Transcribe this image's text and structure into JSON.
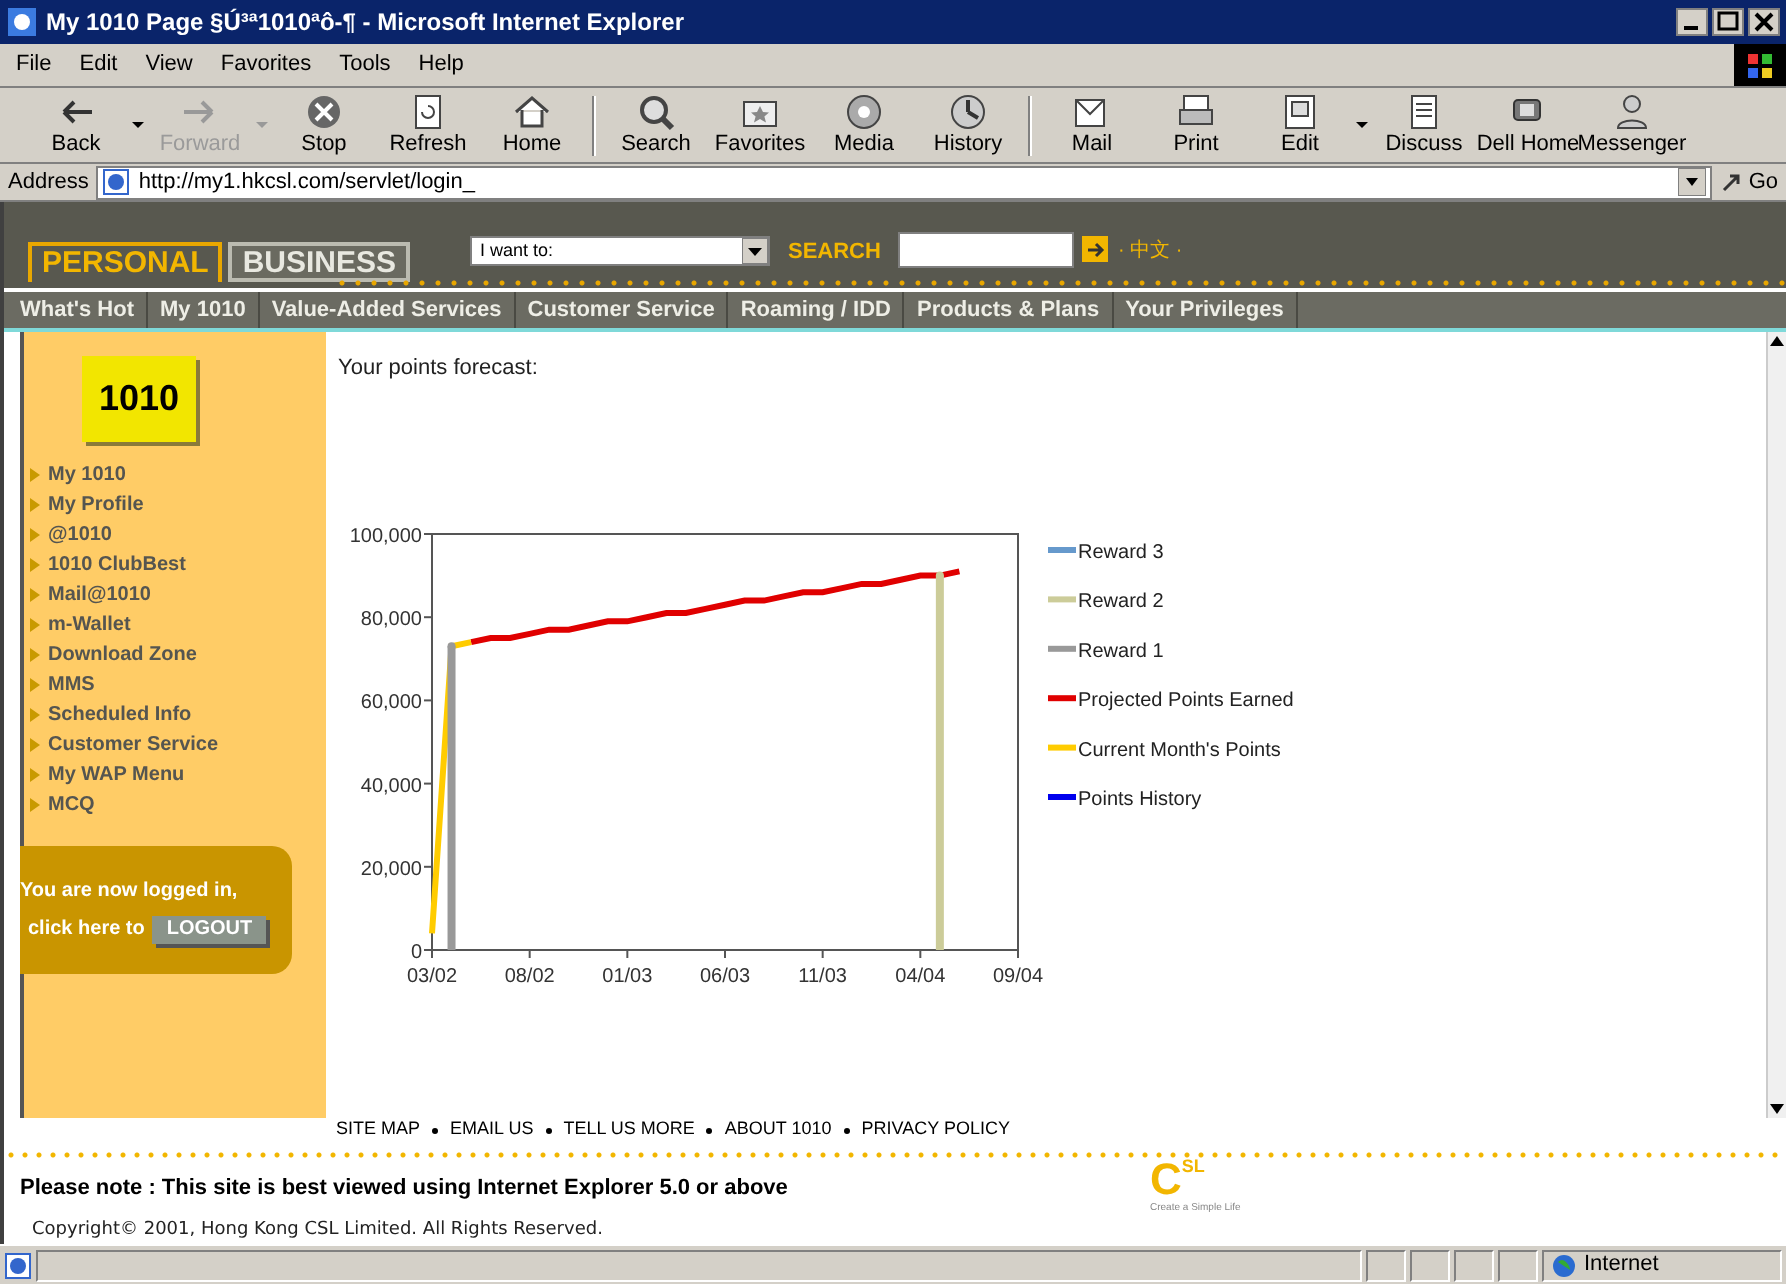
{
  "window": {
    "title": "My 1010 Page §Ú³ª1010ªô-¶ - Microsoft Internet Explorer"
  },
  "menu": [
    "File",
    "Edit",
    "View",
    "Favorites",
    "Tools",
    "Help"
  ],
  "toolbar": [
    {
      "label": "Back",
      "disabled": false,
      "dropdown": true
    },
    {
      "label": "Forward",
      "disabled": true,
      "dropdown": true
    },
    {
      "label": "Stop",
      "disabled": false,
      "dropdown": false
    },
    {
      "label": "Refresh",
      "disabled": false,
      "dropdown": false
    },
    {
      "label": "Home",
      "disabled": false,
      "dropdown": false
    },
    {
      "label": "Search",
      "disabled": false,
      "dropdown": false
    },
    {
      "label": "Favorites",
      "disabled": false,
      "dropdown": false
    },
    {
      "label": "Media",
      "disabled": false,
      "dropdown": false
    },
    {
      "label": "History",
      "disabled": false,
      "dropdown": false
    },
    {
      "label": "Mail",
      "disabled": false,
      "dropdown": false
    },
    {
      "label": "Print",
      "disabled": false,
      "dropdown": false
    },
    {
      "label": "Edit",
      "disabled": false,
      "dropdown": true
    },
    {
      "label": "Discuss",
      "disabled": false,
      "dropdown": false
    },
    {
      "label": "Dell Home",
      "disabled": false,
      "dropdown": false
    },
    {
      "label": "Messenger",
      "disabled": false,
      "dropdown": false
    }
  ],
  "address": {
    "label": "Address",
    "value": "http://my1.hkcsl.com/servlet/login_",
    "go": "Go"
  },
  "site_header": {
    "tabs": [
      {
        "label": "PERSONAL",
        "selected": true
      },
      {
        "label": "BUSINESS",
        "selected": false
      }
    ],
    "select": "I want to:",
    "search_label": "SEARCH",
    "language": "· 中文 ·"
  },
  "nav": [
    "What's Hot",
    "My 1010",
    "Value-Added Services",
    "Customer Service",
    "Roaming / IDD",
    "Products & Plans",
    "Your Privileges"
  ],
  "sidebar": {
    "logo": "1010",
    "items": [
      "My 1010",
      "My Profile",
      "@1010",
      "1010 ClubBest",
      "Mail@1010",
      "m-Wallet",
      "Download Zone",
      "MMS",
      "Scheduled Info",
      "Customer Service",
      "My WAP Menu",
      "MCQ"
    ],
    "login": {
      "line_1": "You are now logged in,",
      "line_2": "click here to",
      "button": "LOGOUT"
    }
  },
  "content": {
    "heading": "Your points forecast:",
    "chart_data": {
      "type": "line",
      "categories": [
        "03/02",
        null,
        null,
        null,
        null,
        "08/02",
        null,
        null,
        null,
        null,
        "01/03",
        null,
        null,
        null,
        null,
        "06/03",
        null,
        null,
        null,
        null,
        "11/03",
        null,
        null,
        null,
        null,
        "04/04",
        null,
        null,
        null,
        null,
        "09/04"
      ],
      "ylim": [
        0,
        100000
      ],
      "legend": true,
      "yticks": [
        {
          "value": 0,
          "label": "0"
        },
        {
          "value": 20000,
          "label": "20,000"
        },
        {
          "value": 40000,
          "label": "40,000"
        },
        {
          "value": 60000,
          "label": "60,000"
        },
        {
          "value": 80000,
          "label": "80,000"
        },
        {
          "value": 100000,
          "label": "100,000"
        }
      ],
      "series": [
        {
          "name": "Reward 3",
          "color": "#6699cc",
          "values": [
            null,
            null,
            null,
            null,
            null,
            null,
            null,
            null,
            null,
            null,
            null,
            null,
            null,
            null,
            null,
            null,
            null,
            null,
            null,
            null,
            null,
            null,
            null,
            null,
            null,
            null,
            null,
            null,
            null,
            null,
            null
          ]
        },
        {
          "name": "Reward 2",
          "color": "#cccc99",
          "marker": true,
          "values": [
            null,
            null,
            null,
            null,
            null,
            null,
            null,
            null,
            null,
            null,
            null,
            null,
            null,
            null,
            null,
            null,
            null,
            null,
            null,
            null,
            null,
            null,
            null,
            null,
            null,
            null,
            90000,
            null,
            null,
            null,
            null
          ]
        },
        {
          "name": "Reward 1",
          "color": "#999999",
          "marker": true,
          "values": [
            null,
            73000,
            null,
            null,
            null,
            null,
            null,
            null,
            null,
            null,
            null,
            null,
            null,
            null,
            null,
            null,
            null,
            null,
            null,
            null,
            null,
            null,
            null,
            null,
            null,
            null,
            null,
            null,
            null,
            null,
            null
          ]
        },
        {
          "name": "Projected Points Earned",
          "color": "#e00000",
          "values": [
            null,
            null,
            74000,
            75000,
            75000,
            76000,
            77000,
            77000,
            78000,
            79000,
            79000,
            80000,
            81000,
            81000,
            82000,
            83000,
            84000,
            84000,
            85000,
            86000,
            86000,
            87000,
            88000,
            88000,
            89000,
            90000,
            90000,
            91000,
            null,
            null,
            null
          ]
        },
        {
          "name": "Current Month's Points",
          "color": "#ffcc00",
          "values": [
            4000,
            73000,
            74000,
            null,
            null,
            null,
            null,
            null,
            null,
            null,
            null,
            null,
            null,
            null,
            null,
            null,
            null,
            null,
            null,
            null,
            null,
            null,
            null,
            null,
            null,
            null,
            null,
            null,
            null,
            null,
            null
          ]
        },
        {
          "name": "Points History",
          "color": "#0000ee",
          "values": [
            null,
            null,
            null,
            null,
            null,
            null,
            null,
            null,
            null,
            null,
            null,
            null,
            null,
            null,
            null,
            null,
            null,
            null,
            null,
            null,
            null,
            null,
            null,
            null,
            null,
            null,
            null,
            null,
            null,
            null,
            null
          ]
        }
      ]
    }
  },
  "footer": {
    "links": [
      "SITE MAP",
      "EMAIL US",
      "TELL US MORE",
      "ABOUT 1010",
      "PRIVACY POLICY"
    ],
    "note": "Please note : This site is best viewed using Internet Explorer 5.0 or above",
    "copyright": "Copyright© 2001, Hong Kong CSL Limited. All Rights Reserved.",
    "logo": {
      "letter": "C",
      "superscript": "SL",
      "tagline": "Create a Simple Life"
    }
  },
  "status_bar": {
    "zone": "Internet"
  }
}
